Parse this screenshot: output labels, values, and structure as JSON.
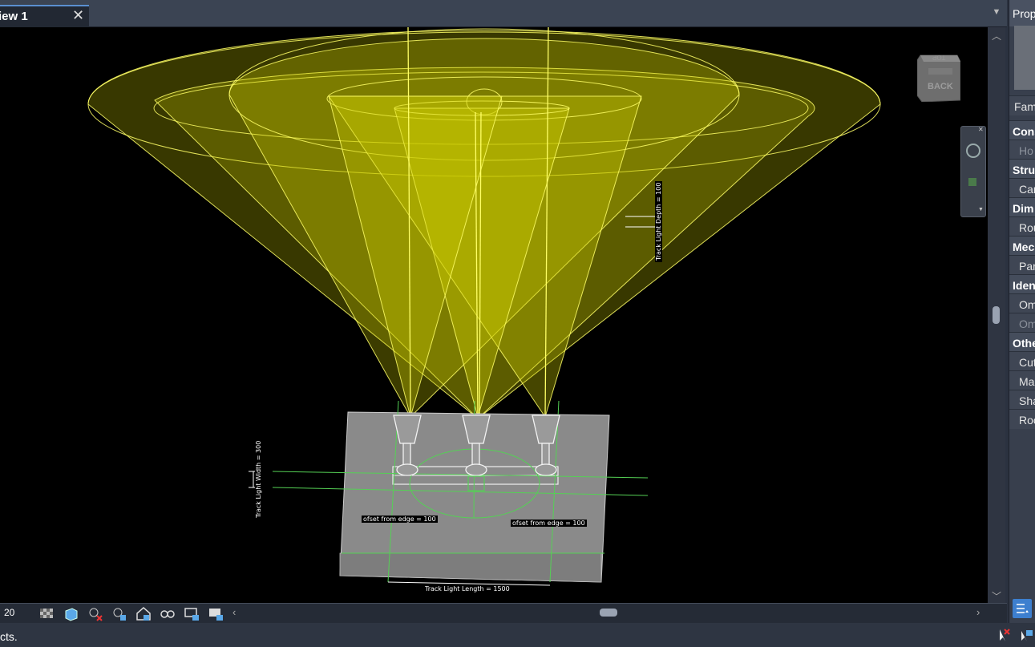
{
  "tab": {
    "title": "iew 1",
    "close_symbol": "✕"
  },
  "view_scale": "20",
  "status_text": "cts.",
  "properties": {
    "title": "Prop",
    "family_tab": "Fam",
    "groups": [
      {
        "label": "Cons",
        "items": [
          {
            "label": "Ho",
            "dim": true
          }
        ]
      },
      {
        "label": "Stru",
        "items": [
          {
            "label": "Car",
            "dim": false
          }
        ]
      },
      {
        "label": "Dim",
        "items": [
          {
            "label": "Rou",
            "dim": false
          }
        ]
      },
      {
        "label": "Mec",
        "items": [
          {
            "label": "Par",
            "dim": false
          }
        ]
      },
      {
        "label": "Iden",
        "items": [
          {
            "label": "Om",
            "dim": false
          },
          {
            "label": "Om",
            "dim": true
          }
        ]
      },
      {
        "label": "Othe",
        "items": [
          {
            "label": "Cut",
            "dim": false
          },
          {
            "label": "Ma",
            "dim": false
          },
          {
            "label": "Sha",
            "dim": false
          },
          {
            "label": "Roo",
            "dim": false
          }
        ]
      }
    ]
  },
  "viewcube": {
    "face_label": "BACK",
    "top_label": "TOP"
  },
  "dimensions": {
    "depth": "Track Light Depth = 100",
    "width": "Track Light Width = 300",
    "offset_left": "ofset from edge = 100",
    "offset_right": "ofset from edge = 100",
    "length": "Track Light Length = 1500"
  },
  "colors": {
    "beam_fill": "#c8c800",
    "beam_edge": "#ffff66",
    "plate": "#8a8a8a",
    "ref_line": "#55d055"
  }
}
